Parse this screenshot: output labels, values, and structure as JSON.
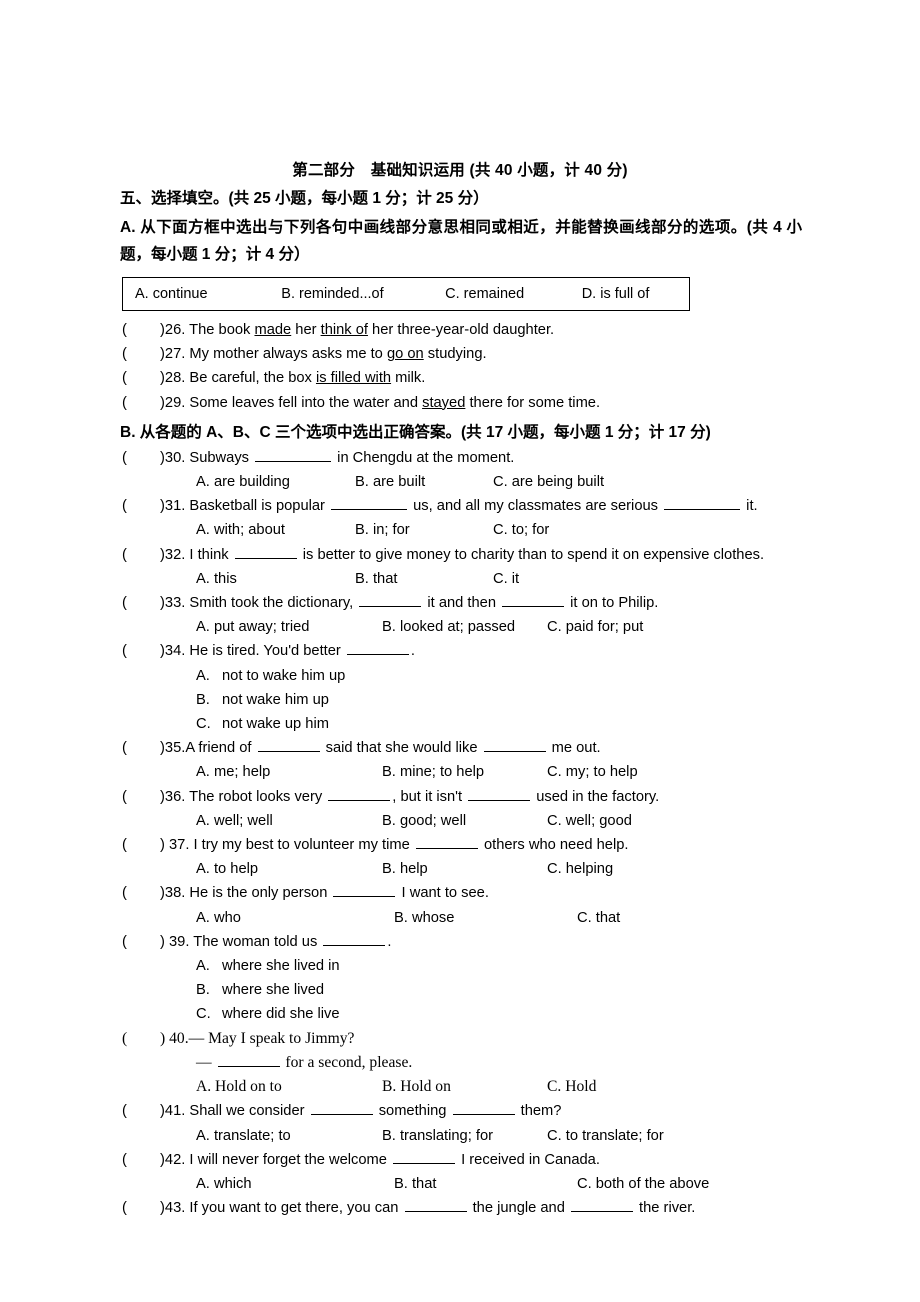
{
  "document": {
    "part_title": "第二部分　基础知识运用 (共 40 小题，计 40 分)",
    "section_line": "五、选择填空。(共 25 小题，每小题 1 分；计 25 分）",
    "sub_head_a": "A. 从下面方框中选出与下列各句中画线部分意思相同或相近，并能替换画线部分的选项。(共 4 小题，每小题 1 分；计 4 分）",
    "sub_head_b": "B. 从各题的 A、B、C 三个选项中选出正确答案。(共 17 小题，每小题 1 分；计 17 分)"
  },
  "word_box": {
    "options": [
      "A. continue",
      "B. reminded...of",
      "C. remained",
      "D. is full of"
    ]
  },
  "part_a_questions": [
    {
      "paren": "(",
      "close": ")",
      "number": "26.",
      "pre": " The book ",
      "u1": "made",
      "mid": " her ",
      "u2": "think of",
      "post": " her three-year-old daughter."
    },
    {
      "paren": "(",
      "close": ")",
      "number": "27.",
      "pre": " My mother always asks me to ",
      "u1": "go on",
      "mid": "",
      "u2": "",
      "post": " studying."
    },
    {
      "paren": "(",
      "close": ")",
      "number": "28.",
      "pre": " Be careful, the box ",
      "u1": "is filled with",
      "mid": "",
      "u2": "",
      "post": " milk."
    },
    {
      "paren": "(",
      "close": ")",
      "number": "29.",
      "pre": " Some leaves fell into the water and ",
      "u1": "stayed",
      "mid": "",
      "u2": "",
      "post": " there for some time."
    }
  ],
  "part_b_questions": [
    {
      "number": "30.",
      "stem_parts": [
        " Subways ",
        " in Chengdu at the moment."
      ],
      "options": [
        "A. are building",
        "B. are built",
        "C. are being built"
      ],
      "layout": "row",
      "spacing": "normal"
    },
    {
      "number": "31.",
      "stem_parts": [
        " Basketball is popular ",
        " us, and all my classmates are serious ",
        " it."
      ],
      "options": [
        "A. with; about",
        "B. in; for",
        "C. to; for"
      ],
      "layout": "row",
      "spacing": "normal"
    },
    {
      "number": "32.",
      "stem_parts": [
        " I think ",
        " is better to give money to charity than to spend it on expensive clothes."
      ],
      "options": [
        "A. this",
        "B. that",
        "C. it"
      ],
      "layout": "row",
      "spacing": "normal"
    },
    {
      "number": "33.",
      "stem_parts": [
        " Smith took the dictionary, ",
        " it and then ",
        " it on to Philip."
      ],
      "options": [
        "A. put away; tried",
        "B. looked at; passed",
        "C. paid for; put"
      ],
      "layout": "row",
      "spacing": "wide"
    },
    {
      "number": "34.",
      "stem_parts": [
        " He is tired. You'd better ",
        "."
      ],
      "options": [
        "not to wake him up",
        "not wake him up",
        "not wake up him"
      ],
      "labels": [
        "A.",
        "B.",
        "C."
      ],
      "layout": "stack"
    },
    {
      "number": "35.",
      "stem_parts": [
        "A friend of ",
        " said that she would like ",
        " me out."
      ],
      "options": [
        "A. me; help",
        "B. mine; to help",
        "C. my; to help"
      ],
      "layout": "row",
      "spacing": "wide"
    },
    {
      "number": "36.",
      "stem_parts": [
        " The robot looks very ",
        ", but it isn't ",
        " used in the factory."
      ],
      "options": [
        "A. well; well",
        "B. good; well",
        "C. well; good"
      ],
      "layout": "row",
      "spacing": "wide"
    },
    {
      "number": " 37.",
      "stem_parts": [
        " I try my best to volunteer my time ",
        " others who need help."
      ],
      "options": [
        "A. to help",
        "B. help",
        "C. helping"
      ],
      "layout": "row",
      "spacing": "wide"
    },
    {
      "number": "38.",
      "stem_parts": [
        " He is the only person ",
        " I want to see."
      ],
      "options": [
        "A. who",
        "B. whose",
        "C. that"
      ],
      "layout": "row",
      "spacing": "xwide"
    },
    {
      "number": " 39.",
      "stem_parts": [
        " The woman told us ",
        "."
      ],
      "options": [
        "where she lived in",
        "where she lived",
        "where did she live"
      ],
      "labels": [
        "A.",
        "B.",
        "C."
      ],
      "layout": "stack"
    },
    {
      "number": " 40.",
      "stem_parts": [
        "— May I speak to Jimmy?"
      ],
      "continuation_pre": "—  ",
      "continuation_post": " for a second, please.",
      "options": [
        "A. Hold on to",
        "B. Hold on",
        "C. Hold"
      ],
      "layout": "dialogue",
      "spacing": "wide",
      "font": "serif"
    },
    {
      "number": "41.",
      "stem_parts": [
        " Shall we consider ",
        " something ",
        " them?"
      ],
      "options": [
        "A. translate; to",
        "B. translating; for",
        "C. to translate; for"
      ],
      "layout": "row",
      "spacing": "wide"
    },
    {
      "number": "42.",
      "stem_parts": [
        " I will never forget the welcome ",
        " I received in Canada."
      ],
      "options": [
        "A. which",
        "B. that",
        "C. both of the above"
      ],
      "layout": "row",
      "spacing": "xwide"
    },
    {
      "number": "43.",
      "stem_parts": [
        " If you want to get there, you can ",
        " the jungle and ",
        " the river."
      ],
      "options": [],
      "layout": "row",
      "spacing": "normal"
    }
  ]
}
